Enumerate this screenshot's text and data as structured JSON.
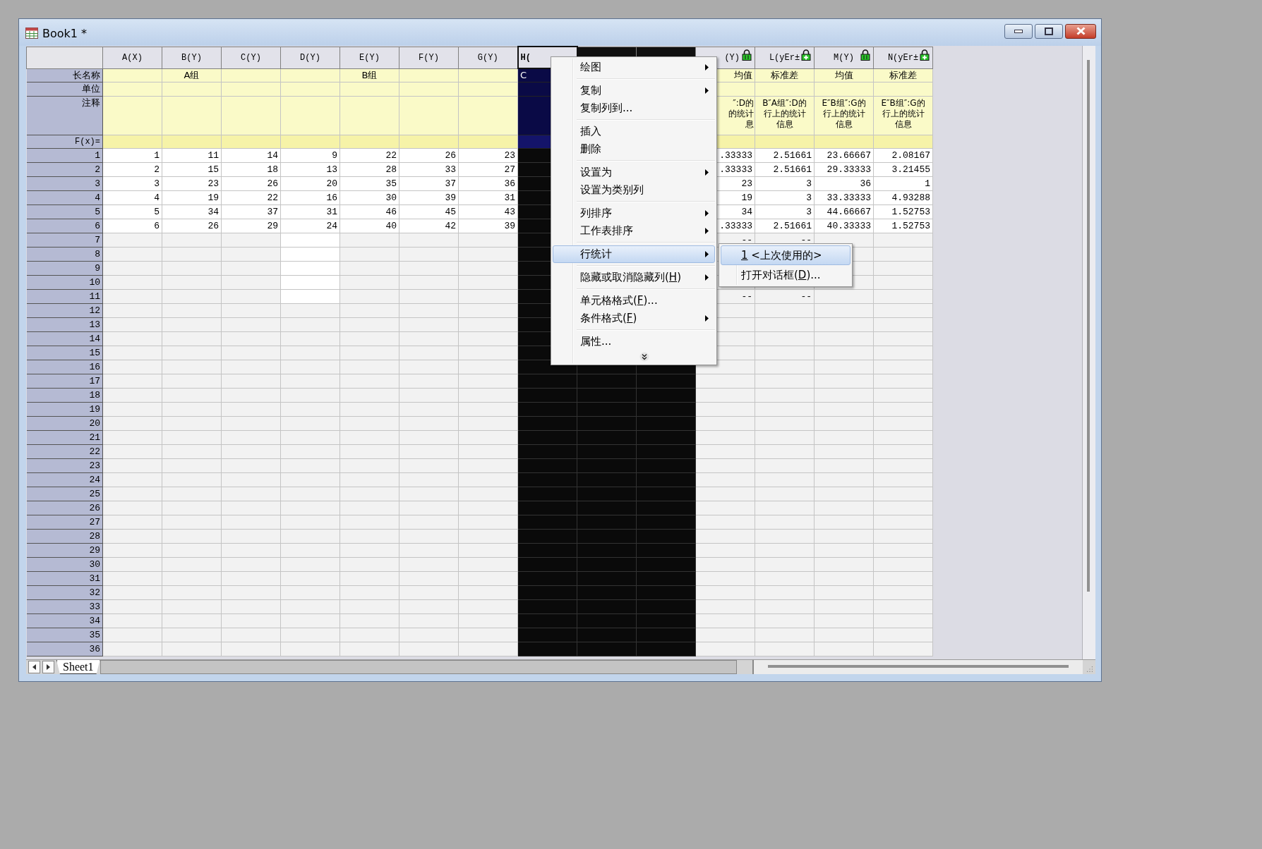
{
  "window": {
    "title": "Book1 *"
  },
  "table": {
    "row_header_labels": {
      "long_name": "长名称",
      "units": "单位",
      "comments": "注释",
      "formula": "F(x)="
    },
    "columns": [
      {
        "label": "A(X)",
        "selected": false,
        "focused": false,
        "locked": false,
        "cells": [
          {
            "text": "1",
            "used": true
          },
          {
            "text": "2",
            "used": true
          },
          {
            "text": "3",
            "used": true
          },
          {
            "text": "4",
            "used": true
          },
          {
            "text": "5",
            "used": true
          },
          {
            "text": "6",
            "used": true
          }
        ]
      },
      {
        "label": "B(Y)",
        "long_name": "A组",
        "selected": false,
        "focused": false,
        "locked": false,
        "cells": [
          {
            "text": "11",
            "used": true
          },
          {
            "text": "15",
            "used": true
          },
          {
            "text": "23",
            "used": true
          },
          {
            "text": "19",
            "used": true
          },
          {
            "text": "34",
            "used": true
          },
          {
            "text": "26",
            "used": true
          }
        ]
      },
      {
        "label": "C(Y)",
        "selected": false,
        "focused": false,
        "locked": false,
        "cells": [
          {
            "text": "14",
            "used": true
          },
          {
            "text": "18",
            "used": true
          },
          {
            "text": "26",
            "used": true
          },
          {
            "text": "22",
            "used": true
          },
          {
            "text": "37",
            "used": true
          },
          {
            "text": "29",
            "used": true
          }
        ]
      },
      {
        "label": "D(Y)",
        "selected": false,
        "focused": false,
        "locked": false,
        "cells": [
          {
            "text": "9",
            "used": true
          },
          {
            "text": "13",
            "used": true
          },
          {
            "text": "20",
            "used": true
          },
          {
            "text": "16",
            "used": true
          },
          {
            "text": "31",
            "used": true
          },
          {
            "text": "24",
            "used": true
          },
          {
            "used": true
          },
          {
            "used": true
          },
          {
            "used": true
          },
          {
            "used": true
          },
          {
            "used": true
          }
        ]
      },
      {
        "label": "E(Y)",
        "long_name": "B组",
        "selected": false,
        "focused": false,
        "locked": false,
        "cells": [
          {
            "text": "22",
            "used": true
          },
          {
            "text": "28",
            "used": true
          },
          {
            "text": "35",
            "used": true
          },
          {
            "text": "30",
            "used": true
          },
          {
            "text": "46",
            "used": true
          },
          {
            "text": "40",
            "used": true
          }
        ]
      },
      {
        "label": "F(Y)",
        "selected": false,
        "focused": false,
        "locked": false,
        "cells": [
          {
            "text": "26",
            "used": true
          },
          {
            "text": "33",
            "used": true
          },
          {
            "text": "37",
            "used": true
          },
          {
            "text": "39",
            "used": true
          },
          {
            "text": "45",
            "used": true
          },
          {
            "text": "42",
            "used": true
          }
        ]
      },
      {
        "label": "G(Y)",
        "selected": false,
        "focused": false,
        "locked": false,
        "cells": [
          {
            "text": "23",
            "used": true
          },
          {
            "text": "27",
            "used": true
          },
          {
            "text": "36",
            "used": true
          },
          {
            "text": "31",
            "used": true
          },
          {
            "text": "43",
            "used": true
          },
          {
            "text": "39",
            "used": true
          }
        ]
      },
      {
        "label": "H(",
        "long_name": "C",
        "selected": true,
        "focused": true,
        "locked": false
      },
      {
        "selected": true,
        "focused": false,
        "locked": false
      },
      {
        "selected": true,
        "focused": false,
        "locked": false
      },
      {
        "label": "(Y)",
        "long_name": "均值",
        "comment": [
          "″:D的",
          "的统计",
          "息"
        ],
        "selected": false,
        "focused": false,
        "locked": true,
        "lock_plus": false,
        "missing_mark": "--",
        "cells": [
          {
            "text": ".33333",
            "used": true
          },
          {
            "text": ".33333",
            "used": true
          },
          {
            "text": "23",
            "used": true
          },
          {
            "text": "19",
            "used": true
          },
          {
            "text": "34",
            "used": true
          },
          {
            "text": ".33333",
            "used": true
          }
        ]
      },
      {
        "label": "L(yEr±",
        "long_name": "标准差",
        "comment": [
          "B″A组″:D的",
          "行上的统计",
          "信息"
        ],
        "selected": false,
        "focused": false,
        "locked": true,
        "lock_plus": true,
        "missing_mark": "--",
        "cells": [
          {
            "text": "2.51661",
            "used": true
          },
          {
            "text": "2.51661",
            "used": true
          },
          {
            "text": "3",
            "used": true
          },
          {
            "text": "3",
            "used": true
          },
          {
            "text": "3",
            "used": true
          },
          {
            "text": "2.51661",
            "used": true
          }
        ]
      },
      {
        "label": "M(Y)",
        "long_name": "均值",
        "comment": [
          "E″B组″:G的",
          "行上的统计",
          "信息"
        ],
        "selected": false,
        "focused": false,
        "locked": true,
        "lock_plus": false,
        "cells": [
          {
            "text": "23.66667",
            "used": true
          },
          {
            "text": "29.33333",
            "used": true
          },
          {
            "text": "36",
            "used": true
          },
          {
            "text": "33.33333",
            "used": true
          },
          {
            "text": "44.66667",
            "used": true
          },
          {
            "text": "40.33333",
            "used": true
          }
        ]
      },
      {
        "label": "N(yEr±",
        "long_name": "标准差",
        "comment": [
          "E″B组″:G的",
          "行上的统计",
          "信息"
        ],
        "selected": false,
        "focused": false,
        "locked": true,
        "lock_plus": true,
        "cells": [
          {
            "text": "2.08167",
            "used": true
          },
          {
            "text": "3.21455",
            "used": true
          },
          {
            "text": "1",
            "used": true
          },
          {
            "text": "4.93288",
            "used": true
          },
          {
            "text": "1.52753",
            "used": true
          },
          {
            "text": "1.52753",
            "used": true
          }
        ]
      }
    ],
    "rows": [
      {
        "label": "1",
        "missing": false
      },
      {
        "label": "2",
        "missing": false
      },
      {
        "label": "3",
        "missing": false
      },
      {
        "label": "4",
        "missing": false
      },
      {
        "label": "5",
        "missing": false
      },
      {
        "label": "6",
        "missing": false
      },
      {
        "label": "7",
        "missing": true
      },
      {
        "label": "8",
        "missing": false
      },
      {
        "label": "9",
        "missing": false
      },
      {
        "label": "10",
        "missing": false
      },
      {
        "label": "11",
        "missing": true
      },
      {
        "label": "12",
        "missing": false
      },
      {
        "label": "13",
        "missing": false
      },
      {
        "label": "14",
        "missing": false
      },
      {
        "label": "15",
        "missing": false
      },
      {
        "label": "16",
        "missing": false
      },
      {
        "label": "17",
        "missing": false
      },
      {
        "label": "18",
        "missing": false
      },
      {
        "label": "19",
        "missing": false
      },
      {
        "label": "20",
        "missing": false
      },
      {
        "label": "21",
        "missing": false
      },
      {
        "label": "22",
        "missing": false
      },
      {
        "label": "23",
        "missing": false
      },
      {
        "label": "24",
        "missing": false
      },
      {
        "label": "25",
        "missing": false
      },
      {
        "label": "26",
        "missing": false
      },
      {
        "label": "27",
        "missing": false
      },
      {
        "label": "28",
        "missing": false
      },
      {
        "label": "29",
        "missing": false
      },
      {
        "label": "30",
        "missing": false
      },
      {
        "label": "31",
        "missing": false
      },
      {
        "label": "32",
        "missing": false
      },
      {
        "label": "33",
        "missing": false
      },
      {
        "label": "34",
        "missing": false
      },
      {
        "label": "35",
        "missing": false
      },
      {
        "label": "36",
        "missing": false
      }
    ]
  },
  "context_menu": {
    "items": [
      {
        "label": "绘图",
        "submenu": true,
        "selected": false
      },
      {
        "kind": "separator"
      },
      {
        "label": "复制",
        "submenu": true,
        "selected": false
      },
      {
        "label": "复制列到...",
        "submenu": false,
        "selected": false
      },
      {
        "kind": "separator"
      },
      {
        "label": "插入",
        "submenu": false,
        "selected": false
      },
      {
        "label": "删除",
        "submenu": false,
        "selected": false
      },
      {
        "kind": "separator"
      },
      {
        "label": "设置为",
        "submenu": true,
        "selected": false
      },
      {
        "label": "设置为类别列",
        "submenu": false,
        "selected": false
      },
      {
        "kind": "separator"
      },
      {
        "label": "列排序",
        "submenu": true,
        "selected": false
      },
      {
        "label": "工作表排序",
        "submenu": true,
        "selected": false
      },
      {
        "kind": "separator"
      },
      {
        "label": "行统计",
        "submenu": true,
        "selected": true,
        "children": [
          {
            "access_key": "1",
            "label_after": " <上次使用的>",
            "selected": true
          },
          {
            "label": "打开对话框(",
            "access_key": "D",
            "label_after": ")...",
            "selected": false
          }
        ]
      },
      {
        "kind": "separator"
      },
      {
        "label": "隐藏或取消隐藏列(",
        "access_key": "H",
        "label_after": ")",
        "submenu": true,
        "selected": false
      },
      {
        "kind": "separator"
      },
      {
        "label": "单元格格式(",
        "access_key": "F",
        "label_after": ")...",
        "submenu": false,
        "selected": false
      },
      {
        "label": "条件格式(",
        "access_key": "F",
        "label_after": ")",
        "submenu": true,
        "selected": false
      },
      {
        "kind": "separator"
      },
      {
        "label": "属性...",
        "submenu": false,
        "selected": false
      }
    ]
  },
  "sheet_tabs": [
    {
      "label": "Sheet1",
      "selected": true
    }
  ]
}
